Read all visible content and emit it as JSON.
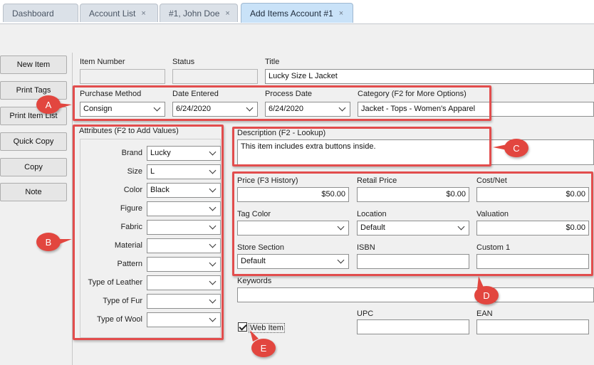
{
  "tabs": [
    {
      "label": "Dashboard",
      "closable": false,
      "active": false
    },
    {
      "label": "Account List",
      "closable": true,
      "active": false
    },
    {
      "label": "#1, John Doe",
      "closable": true,
      "active": false
    },
    {
      "label": "Add Items Account #1",
      "closable": true,
      "active": true
    }
  ],
  "close_glyph": "×",
  "sidebar": {
    "buttons": [
      "New Item",
      "Print Tags",
      "Print Item List",
      "Quick Copy",
      "Copy",
      "Note"
    ]
  },
  "header": {
    "item_number_label": "Item Number",
    "item_number_value": "",
    "status_label": "Status",
    "status_value": "",
    "title_label": "Title",
    "title_value": "Lucky Size L Jacket"
  },
  "purchase": {
    "purchase_method_label": "Purchase Method",
    "purchase_method_value": "Consign",
    "date_entered_label": "Date Entered",
    "date_entered_value": "6/24/2020",
    "process_date_label": "Process Date",
    "process_date_value": "6/24/2020",
    "category_label": "Category (F2 for More Options)",
    "category_value": "Jacket - Tops - Women's Apparel"
  },
  "attributes": {
    "title": "Attributes (F2 to Add Values)",
    "items": [
      {
        "label": "Brand",
        "value": "Lucky"
      },
      {
        "label": "Size",
        "value": "L"
      },
      {
        "label": "Color",
        "value": "Black"
      },
      {
        "label": "Figure",
        "value": ""
      },
      {
        "label": "Fabric",
        "value": ""
      },
      {
        "label": "Material",
        "value": ""
      },
      {
        "label": "Pattern",
        "value": ""
      },
      {
        "label": "Type of Leather",
        "value": ""
      },
      {
        "label": "Type of Fur",
        "value": ""
      },
      {
        "label": "Type of Wool",
        "value": ""
      }
    ]
  },
  "description": {
    "label": "Description (F2 - Lookup)",
    "value": "This item includes extra buttons inside."
  },
  "pricing": {
    "price_label": "Price (F3 History)",
    "price_value": "$50.00",
    "retail_label": "Retail Price",
    "retail_value": "$0.00",
    "cost_label": "Cost/Net",
    "cost_value": "$0.00",
    "tag_color_label": "Tag Color",
    "tag_color_value": "",
    "location_label": "Location",
    "location_value": "Default",
    "valuation_label": "Valuation",
    "valuation_value": "$0.00",
    "store_section_label": "Store Section",
    "store_section_value": "Default",
    "isbn_label": "ISBN",
    "isbn_value": "",
    "custom1_label": "Custom 1",
    "custom1_value": ""
  },
  "keywords": {
    "label": "Keywords",
    "value": ""
  },
  "web_item": {
    "label": "Web Item",
    "checked": true
  },
  "codes": {
    "upc_label": "UPC",
    "upc_value": "",
    "ean_label": "EAN",
    "ean_value": ""
  },
  "callouts": [
    "A",
    "B",
    "C",
    "D",
    "E"
  ],
  "colors": {
    "highlight": "#e24d4d",
    "active_tab": "#c9e2f8",
    "tab": "#dbe1e8",
    "panel": "#f0f0f0"
  }
}
